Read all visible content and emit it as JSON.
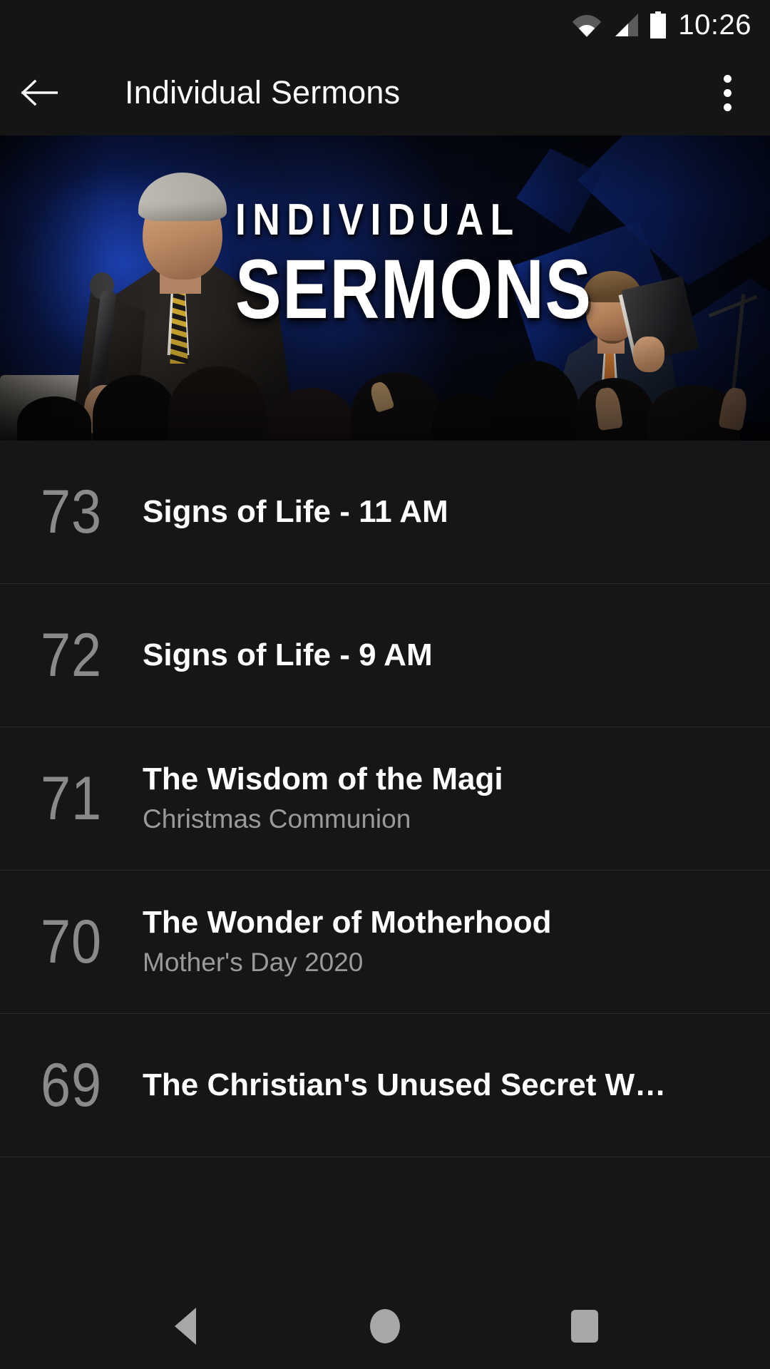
{
  "status_bar": {
    "time": "10:26",
    "icons": [
      "wifi-icon",
      "cellular-signal-icon",
      "battery-icon"
    ]
  },
  "toolbar": {
    "back_icon": "back-arrow-icon",
    "title": "Individual Sermons",
    "overflow_icon": "more-vertical-icon"
  },
  "banner": {
    "title_line1": "INDIVIDUAL",
    "title_line2": "SERMONS",
    "alt": "Preacher on blue-lit stage holding a microphone with a second man holding a Bible"
  },
  "list": {
    "items": [
      {
        "number": "73",
        "title": "Signs of Life - 11 AM",
        "subtitle": ""
      },
      {
        "number": "72",
        "title": "Signs of Life - 9 AM",
        "subtitle": ""
      },
      {
        "number": "71",
        "title": "The Wisdom of the Magi",
        "subtitle": "Christmas Communion"
      },
      {
        "number": "70",
        "title": "The Wonder of Motherhood",
        "subtitle": "Mother's Day 2020"
      },
      {
        "number": "69",
        "title": "The Christian's Unused Secret W…",
        "subtitle": ""
      }
    ]
  },
  "nav_bar": {
    "back_label": "Back",
    "home_label": "Home",
    "recents_label": "Recents"
  },
  "colors": {
    "background": "#161618",
    "toolbar": "#151515",
    "title_text": "#ffffff",
    "number_text": "#8a8a8c",
    "subtitle_text": "#9a9a9c",
    "divider": "#2a2a2c",
    "nav_icon": "#a8a8a8",
    "banner_blue": "#1b49d8"
  }
}
